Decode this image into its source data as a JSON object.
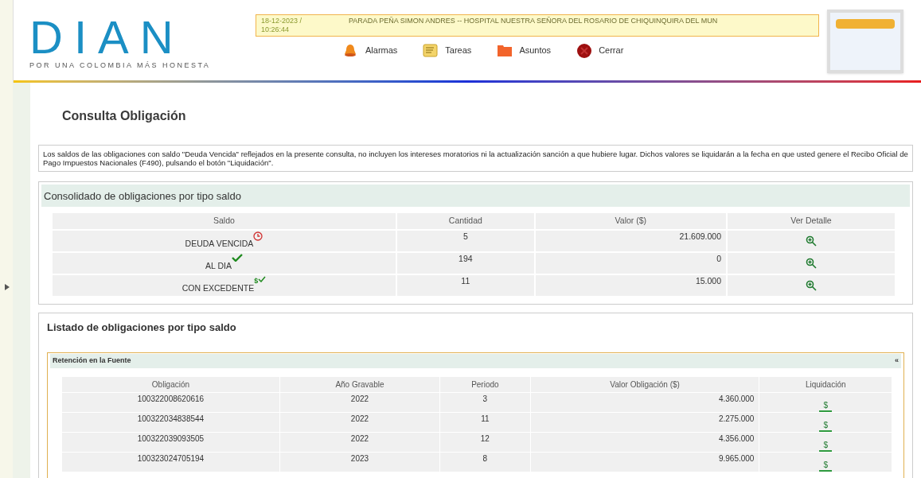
{
  "header": {
    "logo": "DIAN",
    "tagline": "POR UNA COLOMBIA MÁS HONESTA",
    "timestamp": "18-12-2023 / 10:26:44",
    "user": "PARADA PEÑA SIMON ANDRES -- HOSPITAL NUESTRA SEÑORA DEL ROSARIO DE CHIQUINQUIRA DEL MUN",
    "menu": [
      {
        "kind": "alarm",
        "label": "Alarmas"
      },
      {
        "kind": "tasks",
        "label": "Tareas"
      },
      {
        "kind": "folder",
        "label": "Asuntos"
      },
      {
        "kind": "close",
        "label": "Cerrar"
      }
    ]
  },
  "page_title": "Consulta Obligación",
  "notice": "Los saldos de las obligaciones con saldo \"Deuda Vencida\" reflejados en la presente consulta, no incluyen los intereses moratorios ni la actualización sanción a que hubiere lugar. Dichos valores se liquidarán a la fecha en que usted genere el Recibo Oficial de Pago Impuestos Nacionales (F490), pulsando el botón \"Liquidación\".",
  "summary": {
    "title": "Consolidado de obligaciones por tipo saldo",
    "columns": [
      "Saldo",
      "Cantidad",
      "Valor ($)",
      "Ver Detalle"
    ],
    "rows": [
      {
        "kind": "overdue",
        "saldo": "DEUDA VENCIDA",
        "cantidad": "5",
        "valor": "21.609.000"
      },
      {
        "kind": "current",
        "saldo": "AL DIA",
        "cantidad": "194",
        "valor": "0"
      },
      {
        "kind": "surplus",
        "saldo": "CON EXCEDENTE",
        "icon_text": "$",
        "cantidad": "11",
        "valor": "15.000"
      }
    ]
  },
  "listing": {
    "title": "Listado de obligaciones por tipo saldo",
    "group": {
      "title": "Retención en la Fuente",
      "collapse": "«",
      "columns": [
        "Obligación",
        "Año Gravable",
        "Periodo",
        "Valor Obligación ($)",
        "Liquidación"
      ],
      "rows": [
        {
          "obligacion": "100322008620616",
          "anio": "2022",
          "periodo": "3",
          "valor": "4.360.000",
          "button": "$"
        },
        {
          "obligacion": "100322034838544",
          "anio": "2022",
          "periodo": "11",
          "valor": "2.275.000",
          "button": "$"
        },
        {
          "obligacion": "100322039093505",
          "anio": "2022",
          "periodo": "12",
          "valor": "4.356.000",
          "button": "$"
        },
        {
          "obligacion": "100323024705194",
          "anio": "2023",
          "periodo": "8",
          "valor": "9.965.000",
          "button": "$"
        }
      ]
    }
  }
}
